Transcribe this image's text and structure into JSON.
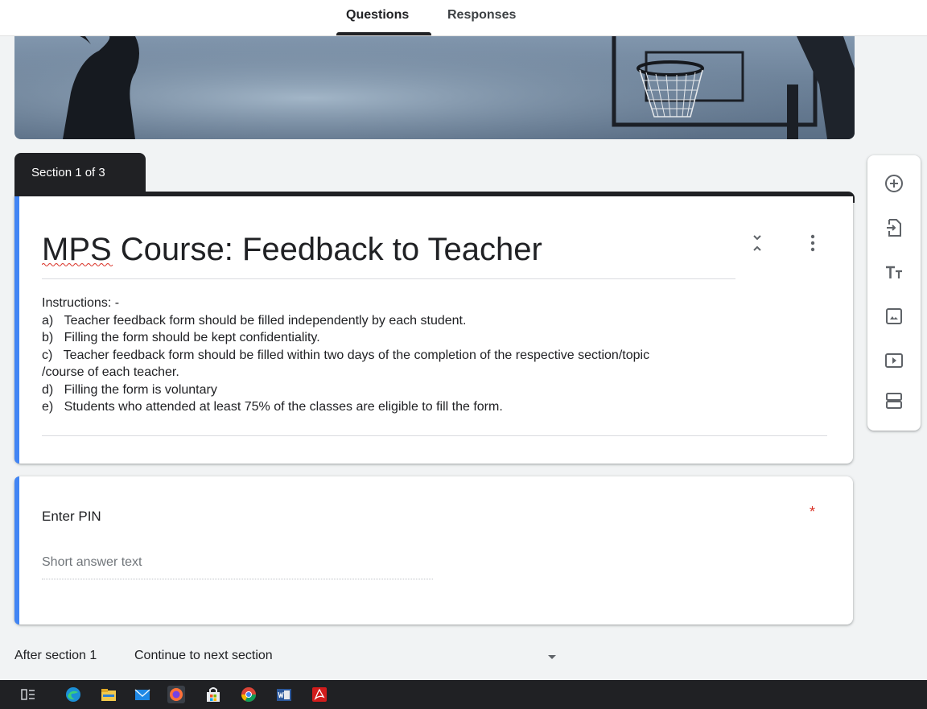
{
  "tabs": {
    "questions": "Questions",
    "responses": "Responses"
  },
  "section": {
    "label": "Section 1 of 3"
  },
  "form": {
    "title": "MPS Course: Feedback to Teacher",
    "description_lines": [
      "Instructions: -",
      "a)   Teacher feedback form should be filled independently by each student.",
      "b)   Filling the form should be kept confidentiality.",
      "c)   Teacher feedback form should be filled within two days of the completion of the respective section/topic",
      "/course of each teacher.",
      "d)   Filling the form is voluntary",
      "e)   Students who attended at least 75% of the classes are eligible to fill the form."
    ]
  },
  "question": {
    "title": "Enter PIN",
    "required_mark": "*",
    "answer_placeholder": "Short answer text"
  },
  "after_section": {
    "label": "After section 1",
    "value": "Continue to next section"
  },
  "tools": [
    "add-question-icon",
    "import-questions-icon",
    "add-title-icon",
    "add-image-icon",
    "add-video-icon",
    "add-section-icon"
  ],
  "taskbar": [
    "task-view-icon",
    "edge-icon",
    "file-explorer-icon",
    "mail-icon",
    "firefox-icon",
    "store-icon",
    "chrome-icon",
    "word-icon",
    "acrobat-icon"
  ],
  "colors": {
    "accent": "#4285f4",
    "section_dark": "#202124",
    "required": "#d93025"
  }
}
